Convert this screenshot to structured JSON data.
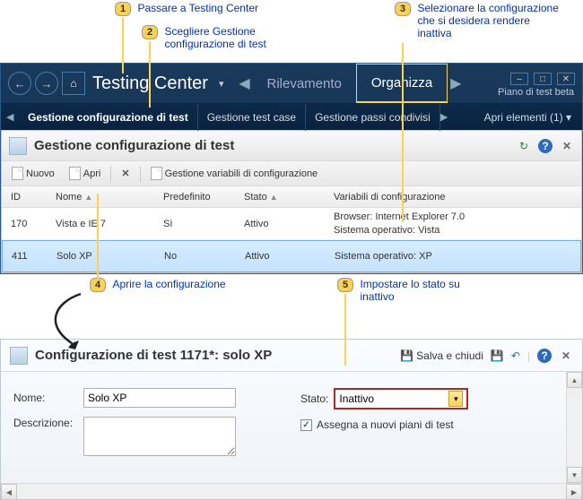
{
  "callouts": {
    "c1": {
      "num": "1",
      "text": "Passare a Testing Center"
    },
    "c2": {
      "num": "2",
      "text": "Scegliere Gestione configurazione di test"
    },
    "c3": {
      "num": "3",
      "text": "Selezionare la configurazione che si desidera rendere inattiva"
    },
    "c4": {
      "num": "4",
      "text": "Aprire la configurazione"
    },
    "c5": {
      "num": "5",
      "text": "Impostare lo stato su inattivo"
    }
  },
  "titlebar": {
    "app_title": "Testing Center",
    "tab_rilevamento": "Rilevamento",
    "tab_organizza": "Organizza",
    "plan_label": "Piano di test beta"
  },
  "subtabs": {
    "t1": "Gestione configurazione di test",
    "t2": "Gestione test case",
    "t3": "Gestione passi condivisi",
    "open_items": "Apri elementi (1)"
  },
  "panel": {
    "title": "Gestione configurazione di test"
  },
  "toolbar": {
    "nuovo": "Nuovo",
    "apri": "Apri",
    "gestione_vars": "Gestione variabili di configurazione"
  },
  "grid": {
    "headers": {
      "id": "ID",
      "nome": "Nome",
      "pred": "Predefinito",
      "stato": "Stato",
      "vars": "Variabili di configurazione"
    },
    "rows": [
      {
        "id": "170",
        "nome": "Vista e IE 7",
        "pred": "Sì",
        "stato": "Attivo",
        "vars": "Browser: Internet Explorer 7.0\nSistema operativo: Vista"
      },
      {
        "id": "411",
        "nome": "Solo XP",
        "pred": "No",
        "stato": "Attivo",
        "vars": "Sistema operativo: XP"
      }
    ]
  },
  "detail": {
    "title": "Configurazione di test 1171*: solo XP",
    "save_close": "Salva e chiudi",
    "nome_label": "Nome:",
    "nome_value": "Solo XP",
    "desc_label": "Descrizione:",
    "desc_value": "",
    "stato_label": "Stato:",
    "stato_value": "Inattivo",
    "assign_label": "Assegna a nuovi piani di test"
  }
}
